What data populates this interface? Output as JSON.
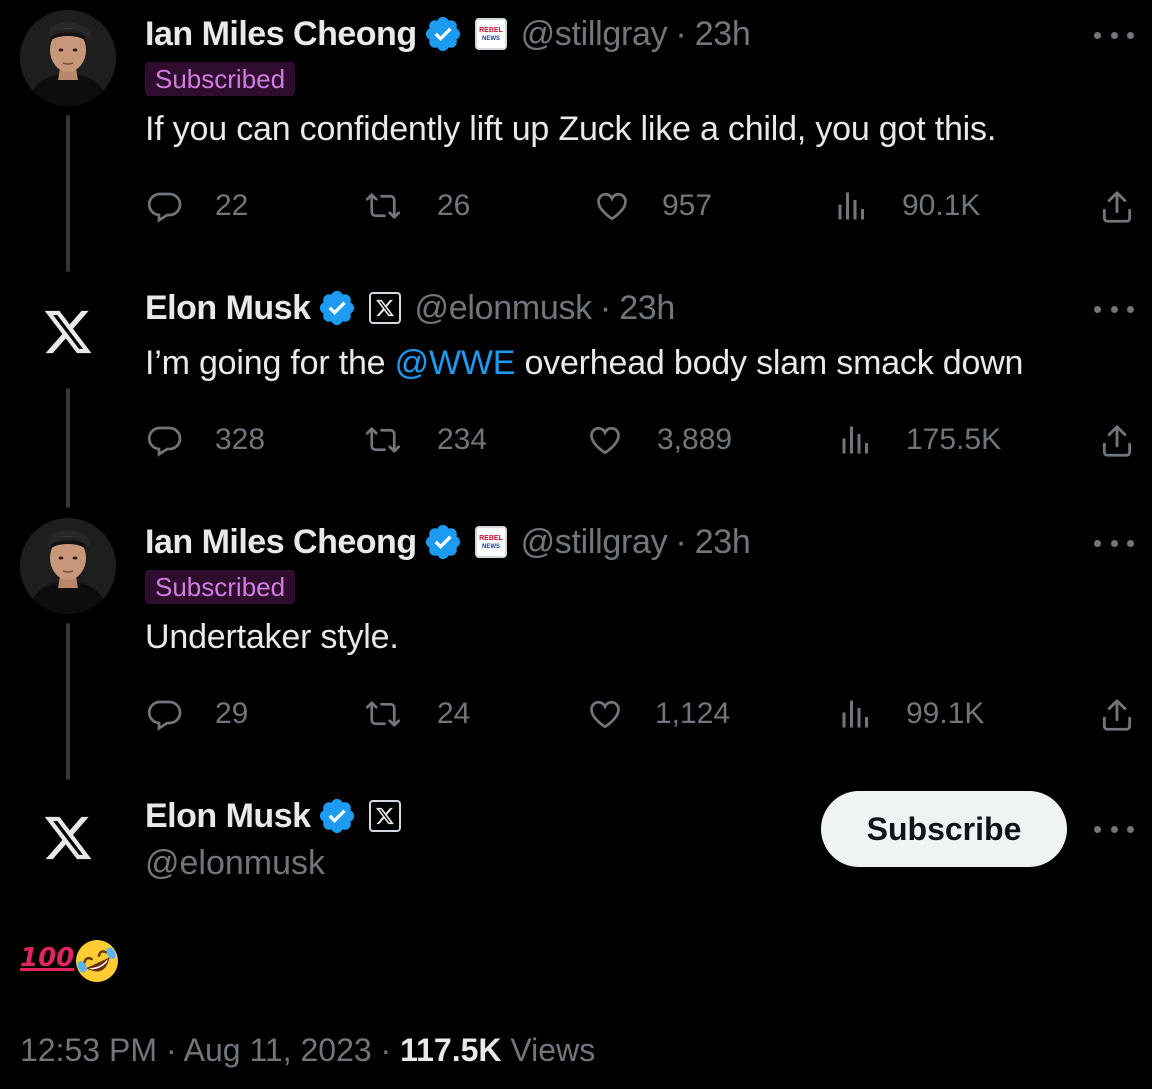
{
  "tweets": [
    {
      "name": "Ian Miles Cheong",
      "handle": "@stillgray",
      "time": "23h",
      "badge": "Subscribed",
      "text": "If you can confidently lift up Zuck like a child, you got this.",
      "replies": "22",
      "reposts": "26",
      "likes": "957",
      "views": "90.1K",
      "affiliate_icon": "rebel-news-logo",
      "affiliate_text": "REBEL NEWS"
    },
    {
      "name": "Elon Musk",
      "handle": "@elonmusk",
      "time": "23h",
      "text_before": "I’m going for the ",
      "mention": "@WWE",
      "text_after": " overhead body slam smack down",
      "replies": "328",
      "reposts": "234",
      "likes": "3,889",
      "views": "175.5K",
      "affiliate_icon": "x-logo"
    },
    {
      "name": "Ian Miles Cheong",
      "handle": "@stillgray",
      "time": "23h",
      "badge": "Subscribed",
      "text": "Undertaker style.",
      "replies": "29",
      "reposts": "24",
      "likes": "1,124",
      "views": "99.1K",
      "affiliate_icon": "rebel-news-logo",
      "affiliate_text": "REBEL NEWS"
    }
  ],
  "main_tweet": {
    "name": "Elon Musk",
    "handle": "@elonmusk",
    "subscribe_label": "Subscribe",
    "emoji_text": "100",
    "emoji_icons": [
      "hundred-points-icon",
      "rolling-laughing-icon"
    ],
    "time": "12:53 PM",
    "date": "Aug 11, 2023",
    "views_count": "117.5K",
    "views_label": "Views"
  },
  "colors": {
    "background": "#000000",
    "text": "#e7e9ea",
    "muted": "#71767b",
    "link": "#1d9bf0",
    "verified": "#1d9bf0",
    "subscribed_bg": "#2f0d2e",
    "subscribed_text": "#d07ce0"
  }
}
